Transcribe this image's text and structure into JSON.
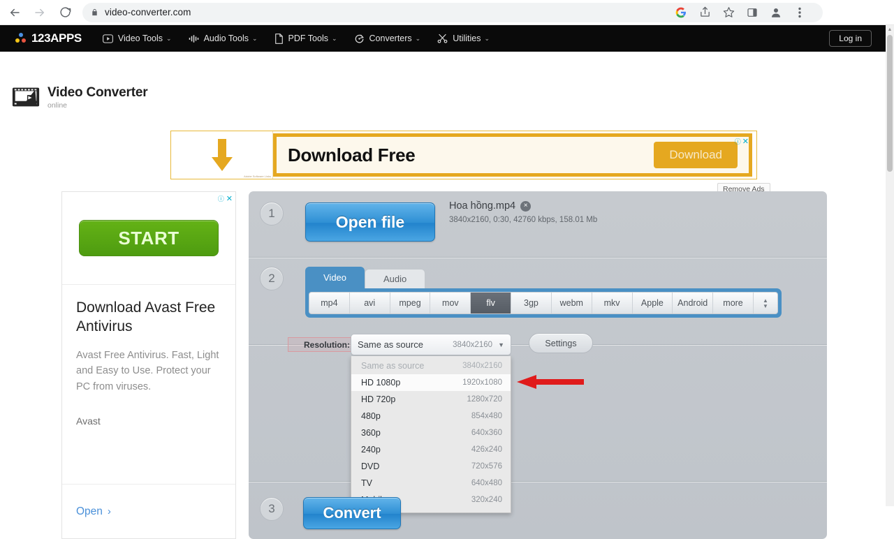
{
  "browser": {
    "url": "video-converter.com",
    "back_icon": "back-arrow-icon",
    "forward_icon": "forward-arrow-icon",
    "reload_icon": "reload-icon",
    "lock_icon": "lock-icon",
    "toolbar_icons": [
      "google-icon",
      "share-icon",
      "bookmark-star-icon",
      "side-panel-icon",
      "profile-avatar-icon",
      "three-dot-menu-icon"
    ]
  },
  "site_nav": {
    "brand": "123APPS",
    "items": [
      {
        "label": "Video Tools",
        "icon": "video-play-icon"
      },
      {
        "label": "Audio Tools",
        "icon": "audio-wave-icon"
      },
      {
        "label": "PDF Tools",
        "icon": "document-icon"
      },
      {
        "label": "Converters",
        "icon": "convert-circle-icon"
      },
      {
        "label": "Utilities",
        "icon": "scissors-icon"
      }
    ],
    "caret": "⌄",
    "login_label": "Log in"
  },
  "logo": {
    "title": "Video Converter",
    "subtitle": "online"
  },
  "top_ad": {
    "headline": "Download Free",
    "cta_label": "Download",
    "attribution": "Adobe\nSoftware Links",
    "info_icon": "ad-info-icon",
    "close_icon": "ad-close-icon"
  },
  "remove_ads_label": "Remove Ads",
  "side_ad": {
    "start_label": "START",
    "title": "Download Avast Free Antivirus",
    "description": "Avast Free Antivirus. Fast, Light and Easy to Use. Protect your PC from viruses.",
    "brand": "Avast",
    "open_label": "Open",
    "open_chevron": "›",
    "info_icon": "ad-info-icon",
    "close_icon": "ad-close-icon"
  },
  "converter": {
    "steps": {
      "one": "1",
      "two": "2",
      "three": "3"
    },
    "open_file_label": "Open file",
    "convert_label": "Convert",
    "file": {
      "name": "Hoa hồng.mp4",
      "remove_icon": "×",
      "meta": "3840x2160, 0:30, 42760 kbps, 158.01 Mb"
    },
    "tabs": [
      {
        "label": "Video",
        "active": true
      },
      {
        "label": "Audio",
        "active": false
      }
    ],
    "formats": [
      {
        "label": "mp4",
        "selected": false
      },
      {
        "label": "avi",
        "selected": false
      },
      {
        "label": "mpeg",
        "selected": false
      },
      {
        "label": "mov",
        "selected": false
      },
      {
        "label": "flv",
        "selected": true
      },
      {
        "label": "3gp",
        "selected": false
      },
      {
        "label": "webm",
        "selected": false
      },
      {
        "label": "mkv",
        "selected": false
      },
      {
        "label": "Apple",
        "selected": false
      },
      {
        "label": "Android",
        "selected": false
      },
      {
        "label": "more",
        "selected": false
      }
    ],
    "format_spinner": {
      "up": "▲",
      "down": "▼"
    },
    "resolution_label": "Resolution:",
    "resolution_selected": {
      "label": "Same as source",
      "dimension": "3840x2160"
    },
    "resolution_caret": "▼",
    "resolution_options": [
      {
        "label": "Same as source",
        "dimension": "3840x2160",
        "state": "disabled"
      },
      {
        "label": "HD 1080p",
        "dimension": "1920x1080",
        "state": "highlight"
      },
      {
        "label": "HD 720p",
        "dimension": "1280x720",
        "state": "normal"
      },
      {
        "label": "480p",
        "dimension": "854x480",
        "state": "normal"
      },
      {
        "label": "360p",
        "dimension": "640x360",
        "state": "normal"
      },
      {
        "label": "240p",
        "dimension": "426x240",
        "state": "normal"
      },
      {
        "label": "DVD",
        "dimension": "720x576",
        "state": "normal"
      },
      {
        "label": "TV",
        "dimension": "640x480",
        "state": "normal"
      },
      {
        "label": "Mobile",
        "dimension": "320x240",
        "state": "normal"
      }
    ],
    "settings_label": "Settings"
  },
  "annotation": {
    "arrow": "red-left-arrow",
    "color": "#e01b1b"
  },
  "colors": {
    "nav_bg": "#0a0a0a",
    "panel_bg": "#c4c8ce",
    "primary_blue": "#2e8fd4",
    "tab_blue": "#4a90c4",
    "ad_yellow": "#e5a820",
    "ad_green": "#5aa713",
    "link_blue": "#4a90d9",
    "highlight_pink": "#d99aa0"
  }
}
